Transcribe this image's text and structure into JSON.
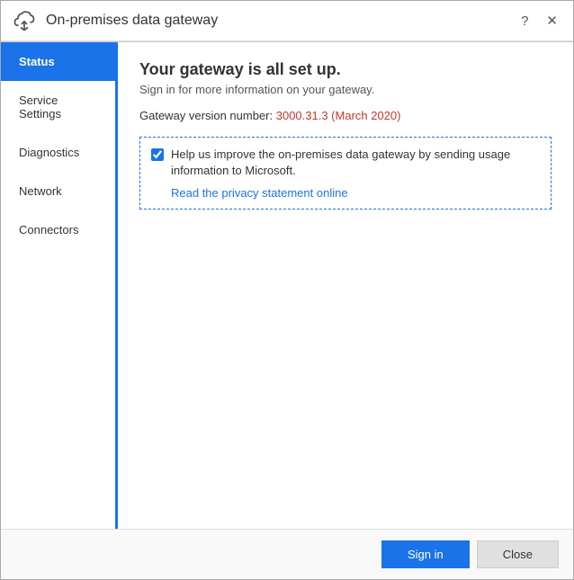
{
  "titleBar": {
    "title": "On-premises data gateway",
    "helpBtn": "?",
    "closeBtn": "✕"
  },
  "sidebar": {
    "items": [
      {
        "id": "status",
        "label": "Status",
        "active": true
      },
      {
        "id": "service-settings",
        "label": "Service Settings",
        "active": false
      },
      {
        "id": "diagnostics",
        "label": "Diagnostics",
        "active": false
      },
      {
        "id": "network",
        "label": "Network",
        "active": false
      },
      {
        "id": "connectors",
        "label": "Connectors",
        "active": false
      }
    ]
  },
  "main": {
    "heading": "Your gateway is all set up.",
    "subtext": "Sign in for more information on your gateway.",
    "versionLabel": "Gateway version number: ",
    "versionNumber": "3000.31.3 (March 2020)",
    "checkboxLabel": "Help us improve the on-premises data gateway by sending usage information to Microsoft.",
    "checkboxChecked": true,
    "privacyLinkText": "Read the privacy statement online"
  },
  "footer": {
    "signInLabel": "Sign in",
    "closeLabel": "Close"
  }
}
